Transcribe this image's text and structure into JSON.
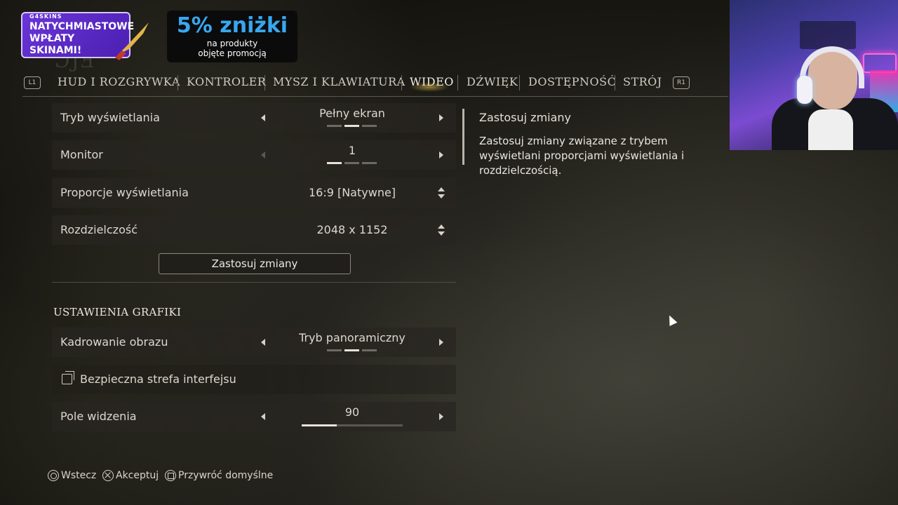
{
  "ad": {
    "brand": "G4SKINS",
    "line1": "NATYCHMIASTOWE",
    "line2": "WPŁATY SKINAMI!",
    "discount": "5% zniżki",
    "sub1": "na produkty",
    "sub2": "objęte promocją"
  },
  "nav": {
    "left_bumper": "L1",
    "right_bumper": "R1",
    "tabs": [
      "HUD I ROZGRYWKA",
      "KONTROLER",
      "MYSZ I KLAWIATURA",
      "WIDEO",
      "DŹWIĘK",
      "DOSTĘPNOŚĆ",
      "STRÓJ"
    ],
    "active_tab": "WIDEO"
  },
  "display": {
    "mode": {
      "label": "Tryb wyświetlania",
      "value": "Pełny ekran",
      "options_count": 3,
      "selected_index": 1
    },
    "monitor": {
      "label": "Monitor",
      "value": "1",
      "options_count": 3,
      "selected_index": 0
    },
    "aspect": {
      "label": "Proporcje wyświetlania",
      "value": "16:9 [Natywne]"
    },
    "resolution": {
      "label": "Rozdzielczość",
      "value": "2048 x 1152"
    },
    "apply_label": "Zastosuj zmiany"
  },
  "graphics": {
    "section_title": "USTAWIENIA GRAFIKI",
    "framing": {
      "label": "Kadrowanie obrazu",
      "value": "Tryb panoramiczny",
      "options_count": 3,
      "selected_index": 1
    },
    "safe_zone": {
      "label": "Bezpieczna strefa interfejsu"
    },
    "fov": {
      "label": "Pole widzenia",
      "value": "90",
      "fill_fraction": 0.35
    }
  },
  "description": {
    "title": "Zastosuj zmiany",
    "text": "Zastosuj zmiany związane z trybem wyświetlani proporcjami wyświetlania i rozdzielczością."
  },
  "footer": {
    "back": "Wstecz",
    "accept": "Akceptuj",
    "reset": "Przywróć domyślne"
  }
}
